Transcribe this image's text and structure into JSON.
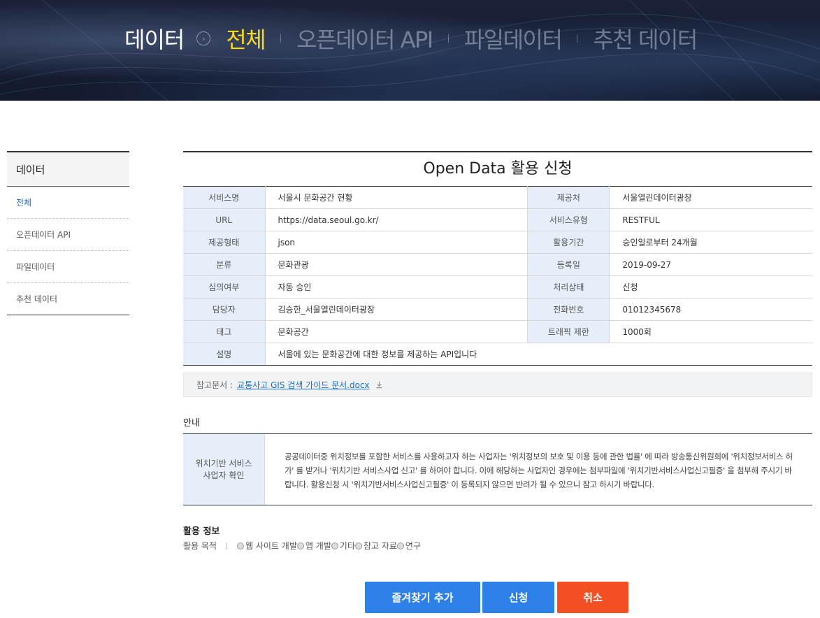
{
  "hero": {
    "root": "데이터",
    "nav": [
      {
        "label": "전체",
        "active": true
      },
      {
        "label": "오픈데이터 API",
        "active": false
      },
      {
        "label": "파일데이터",
        "active": false
      },
      {
        "label": "추천 데이터",
        "active": false
      }
    ]
  },
  "sidebar": {
    "title": "데이터",
    "items": [
      {
        "label": "전체",
        "active": true
      },
      {
        "label": "오픈데이터 API",
        "active": false
      },
      {
        "label": "파일데이터",
        "active": false
      },
      {
        "label": "추천 데이터",
        "active": false
      }
    ]
  },
  "main": {
    "title": "Open Data 활용 신청",
    "rows": [
      {
        "k1": "서비스명",
        "v1": "서울시 문화공간 현황",
        "k2": "제공처",
        "v2": "서울열린데이터광장"
      },
      {
        "k1": "URL",
        "v1": "https://data.seoul.go.kr/",
        "k2": "서비스유형",
        "v2": "RESTFUL"
      },
      {
        "k1": "제공형태",
        "v1": "json",
        "k2": "활용기간",
        "v2": "승인일로부터 24개월"
      },
      {
        "k1": "분류",
        "v1": "문화관광",
        "k2": "등록일",
        "v2": "2019-09-27"
      },
      {
        "k1": "심의여부",
        "v1": "자동 승인",
        "k2": "처리상태",
        "v2": "신청"
      },
      {
        "k1": "담당자",
        "v1": "김승한_서울열린데이터광장",
        "k2": "전화번호",
        "v2": "01012345678"
      },
      {
        "k1": "태그",
        "v1": "문화공간",
        "k2": "트래픽 제한",
        "v2": "1000회"
      }
    ],
    "description": {
      "label": "설명",
      "value": "서울에 있는 문화공간에 대한 정보를 제공하는 API입니다"
    },
    "reference": {
      "label": "참고문서 :",
      "link": "교통사고 GIS 검색 가이드 문서.docx",
      "icon": "download-icon"
    },
    "notice": {
      "title": "안내",
      "label_line1": "위치기반 서비스",
      "label_line2": "사업자 확인",
      "body": "공공데이터중 위치정보를 포함한 서비스를 사용하고자 하는 사업자는 '위치정보의 보호 및 이용 등에 관한 법률' 에 따라 방송통신위원회에 '위치정보서비스 허가' 를 받거나 '위치기반 서비스사업 신고' 를 하여야 합니다. 이에 해당하는 사업자인 경우에는 첨부파일에 '위치기반서비스사업신고필증' 을 첨부해 주시기 바랍니다. 활용신청 시 '위치기반서비스사업신고필증' 이 등록되지 않으면 반려가 될 수 있으니 참고 하시기 바랍니다."
    },
    "usage": {
      "title": "활용 정보",
      "purpose_label": "활용 목적",
      "options": [
        "웹 사이트 개발",
        "앱 개발",
        "기타",
        "참고 자료",
        "연구"
      ]
    }
  },
  "buttons": {
    "favorite": "즐겨찾기 추가",
    "apply": "신청",
    "cancel": "취소"
  },
  "colors": {
    "primary": "#2d80e8",
    "danger": "#f24f23",
    "highlight": "#f5d71d",
    "header_cell": "#e6eef9"
  }
}
